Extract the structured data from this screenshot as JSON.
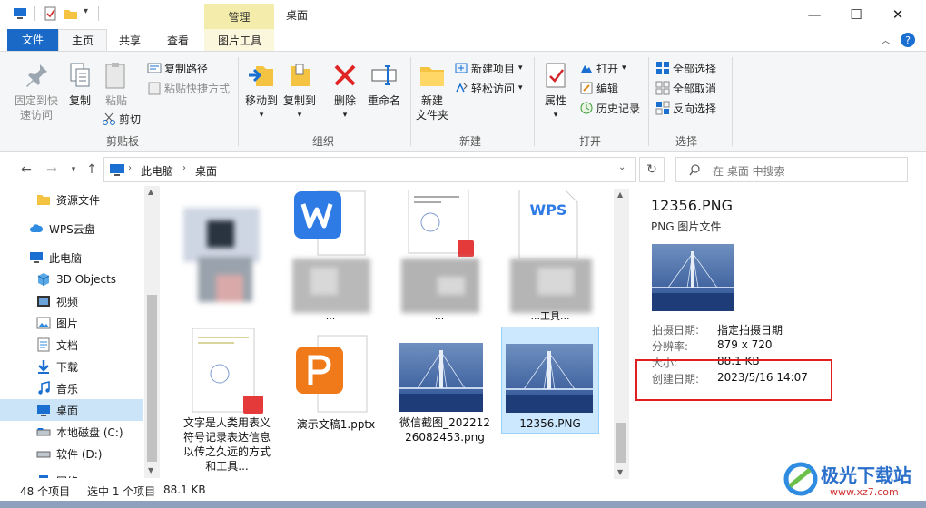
{
  "window": {
    "context_tab": "管理",
    "title": "桌面",
    "minimize_glyph": "—",
    "maximize_glyph": "☐",
    "close_glyph": "✕"
  },
  "tabs": [
    {
      "label": "文件"
    },
    {
      "label": "主页"
    },
    {
      "label": "共享"
    },
    {
      "label": "查看"
    },
    {
      "label": "图片工具"
    }
  ],
  "ribbon": {
    "clipboard": {
      "pin_label": "固定到快\n速访问",
      "copy_label": "复制",
      "paste_label": "粘贴",
      "copy_path": "复制路径",
      "paste_shortcut": "粘贴快捷方式",
      "cut": "剪切",
      "group": "剪贴板"
    },
    "organize": {
      "move_to": "移动到",
      "copy_to": "复制到",
      "delete": "删除",
      "rename": "重命名",
      "group": "组织"
    },
    "new": {
      "new_folder": "新建\n文件夹",
      "new_item": "新建项目",
      "easy_access": "轻松访问",
      "group": "新建"
    },
    "open": {
      "properties": "属性",
      "open": "打开",
      "edit": "编辑",
      "history": "历史记录",
      "group": "打开"
    },
    "select": {
      "select_all": "全部选择",
      "select_none": "全部取消",
      "invert": "反向选择",
      "group": "选择"
    }
  },
  "address": {
    "crumbs": [
      "此电脑",
      "桌面"
    ],
    "search_placeholder": "在 桌面 中搜索"
  },
  "sidebar": {
    "items": [
      {
        "label": "资源文件",
        "icon": "folder-icon"
      },
      {
        "label": "WPS云盘",
        "icon": "cloud-icon"
      },
      {
        "label": "此电脑",
        "icon": "computer-icon"
      },
      {
        "label": "3D Objects",
        "icon": "cube-icon"
      },
      {
        "label": "视频",
        "icon": "video-icon"
      },
      {
        "label": "图片",
        "icon": "picture-icon"
      },
      {
        "label": "文档",
        "icon": "document-icon"
      },
      {
        "label": "下载",
        "icon": "download-icon"
      },
      {
        "label": "音乐",
        "icon": "music-icon"
      },
      {
        "label": "桌面",
        "icon": "desktop-icon"
      },
      {
        "label": "本地磁盘 (C:)",
        "icon": "drive-icon"
      },
      {
        "label": "软件 (D:)",
        "icon": "drive-icon"
      },
      {
        "label": "网络",
        "icon": "network-icon"
      }
    ]
  },
  "files": [
    {
      "name": "",
      "kind": "blurred-image"
    },
    {
      "name": "",
      "kind": "wps-writer"
    },
    {
      "name": "",
      "kind": "pdf-doc"
    },
    {
      "name": "",
      "kind": "wps-doc"
    },
    {
      "name": "文字是人类用表义符号记录表达信息以传之久远的方式和工具...",
      "kind": "pdf-doc"
    },
    {
      "name": "演示文稿1.pptx",
      "kind": "wps-presentation"
    },
    {
      "name": "微信截图_20221226082453.png",
      "kind": "bridge-image"
    },
    {
      "name": "12356.PNG",
      "kind": "bridge-image",
      "selected": true
    }
  ],
  "truncated_labels": [
    "...",
    "...",
    "...",
    "...工具..."
  ],
  "details": {
    "filename": "12356.PNG",
    "filetype": "PNG 图片文件",
    "props": [
      {
        "key": "拍摄日期:",
        "value": "指定拍摄日期"
      },
      {
        "key": "分辨率:",
        "value": "879 x 720"
      },
      {
        "key": "大小:",
        "value": "88.1 KB"
      },
      {
        "key": "创建日期:",
        "value": "2023/5/16 14:07"
      }
    ],
    "highlight_color": "#e02020"
  },
  "status": {
    "count": "48 个项目",
    "selected": "选中 1 个项目",
    "size": "88.1 KB"
  },
  "watermark": {
    "text": "极光下载站",
    "url": "www.xz7.com"
  },
  "colors": {
    "accent": "#1a69c6",
    "selection": "#cce8ff",
    "context_tab": "#f4ecaa"
  }
}
